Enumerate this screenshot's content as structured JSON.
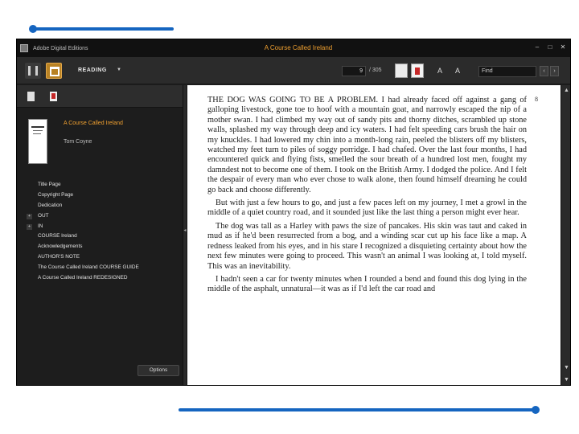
{
  "window": {
    "app_name": "Adobe Digital Editions",
    "document_title": "A Course Called Ireland",
    "controls": {
      "minimize": "–",
      "maximize": "□",
      "close": "✕"
    }
  },
  "toolbar": {
    "view_mode": "READING",
    "view_mode_caret": "▼",
    "current_page": "9",
    "total_pages": "/ 305",
    "font_smaller": "A",
    "font_larger": "A",
    "find_placeholder": "Find",
    "find_prev": "‹",
    "find_next": "›"
  },
  "sidebar": {
    "book_title": "A Course Called Ireland",
    "book_author": "Tom Coyne",
    "toc": [
      {
        "label": "Title Page",
        "expander": ""
      },
      {
        "label": "Copyright Page",
        "expander": ""
      },
      {
        "label": "Dedication",
        "expander": ""
      },
      {
        "label": "OUT",
        "expander": "+"
      },
      {
        "label": "IN",
        "expander": "+"
      },
      {
        "label": "COURSE Ireland",
        "expander": ""
      },
      {
        "label": "Acknowledgements",
        "expander": ""
      },
      {
        "label": "AUTHOR'S NOTE",
        "expander": ""
      },
      {
        "label": "The Course Called Ireland COURSE GUIDE",
        "expander": ""
      },
      {
        "label": "A Course Called Ireland REDESIGNED",
        "expander": ""
      }
    ],
    "options_label": "Options"
  },
  "reader": {
    "page_number": "8",
    "paragraphs": [
      "THE DOG WAS GOING TO BE A PROBLEM. I had already faced off against a gang of galloping livestock, gone toe to hoof with a mountain goat, and narrowly escaped the nip of a mother swan. I had climbed my way out of sandy pits and thorny ditches, scrambled up stone walls, splashed my way through deep and icy waters. I had felt speeding cars brush the hair on my knuckles. I had lowered my chin into a month-long rain, peeled the blisters off my blisters, watched my feet turn to piles of soggy porridge. I had chafed. Over the last four months, I had encountered quick and flying fists, smelled the sour breath of a hundred lost men, fought my damndest not to become one of them. I took on the British Army. I dodged the police. And I felt the despair of every man who ever chose to walk alone, then found himself dreaming he could go back and choose differently.",
      "But with just a few hours to go, and just a few paces left on my journey, I met a growl in the middle of a quiet country road, and it sounded just like the last thing a person might ever hear.",
      "The dog was tall as a Harley with paws the size of pancakes. His skin was taut and caked in mud as if he'd been resurrected from a bog, and a winding scar cut up his face like a map. A redness leaked from his eyes, and in his stare I recognized a disquieting certainty about how the next few minutes were going to proceed. This wasn't an animal I was looking at, I told myself. This was an inevitability.",
      "I hadn't seen a car for twenty minutes when I rounded a bend and found this dog lying in the middle of the asphalt, unnatural—it was as if I'd left the car road and"
    ]
  },
  "scrollbar": {
    "up": "▲",
    "down": "▼"
  },
  "colors": {
    "accent": "#f0a030",
    "decoration": "#1565c0",
    "chrome": "#1e1e1e",
    "page": "#ffffff"
  }
}
